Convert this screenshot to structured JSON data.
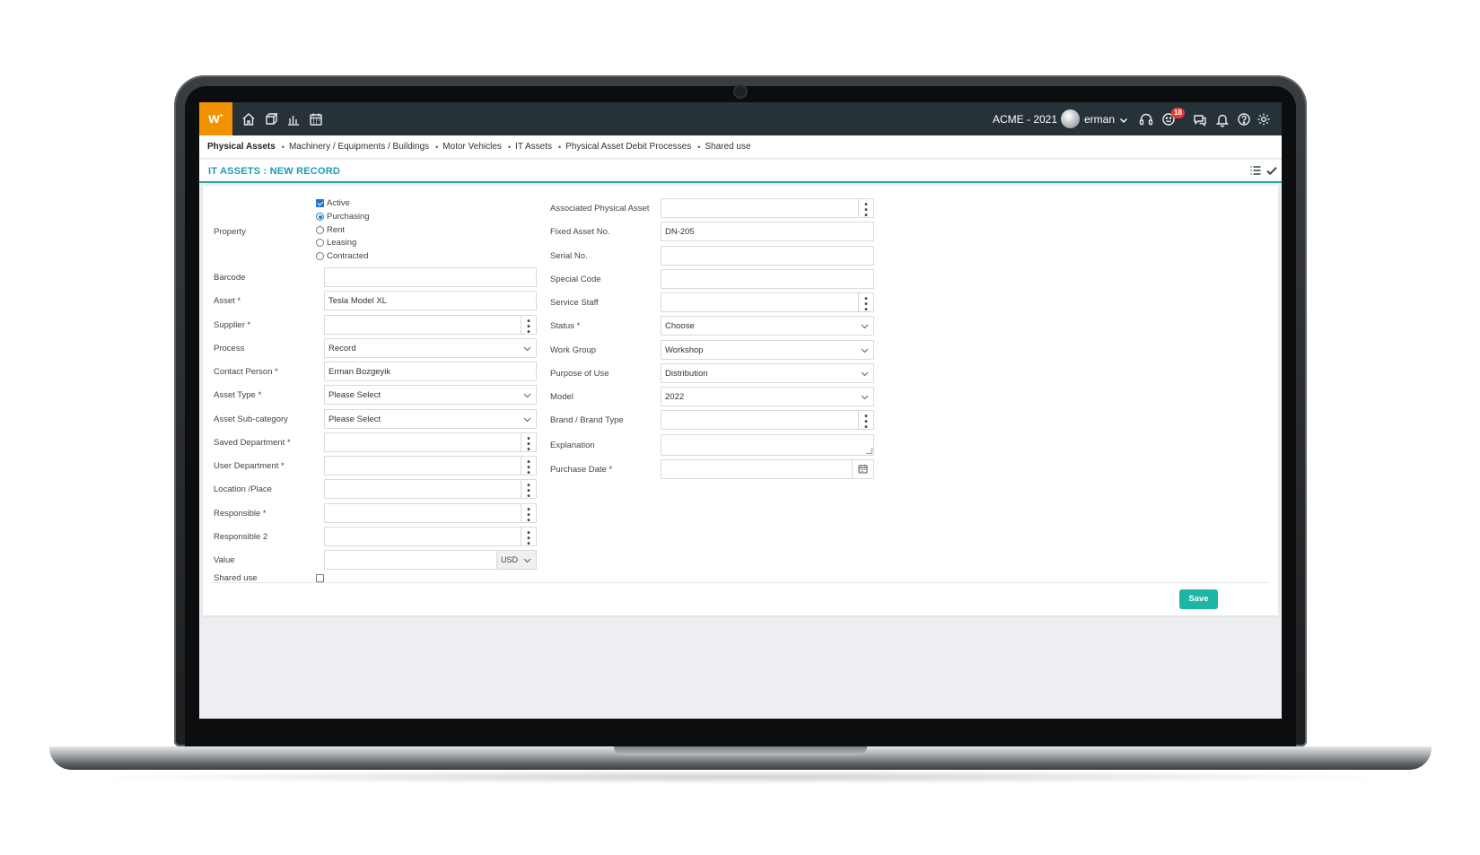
{
  "logo": {
    "text": "w"
  },
  "header": {
    "company": "ACME - 2021",
    "user": "erman",
    "notification_count": "18"
  },
  "breadcrumb": [
    "Physical Assets",
    "Machinery / Equipments / Buildings",
    "Motor Vehicles",
    "IT Assets",
    "Physical Asset Debit Processes",
    "Shared use"
  ],
  "page": {
    "title": "IT ASSETS : NEW RECORD"
  },
  "form_left": {
    "property_label": "Property",
    "active_label": "Active",
    "active_checked": true,
    "property_options": [
      "Purchasing",
      "Rent",
      "Leasing",
      "Contracted"
    ],
    "property_selected": "Purchasing",
    "fields": {
      "barcode": {
        "label": "Barcode",
        "value": ""
      },
      "asset": {
        "label": "Asset *",
        "value": "Tesla Model XL"
      },
      "supplier": {
        "label": "Supplier *",
        "value": ""
      },
      "process": {
        "label": "Process",
        "value": "Record"
      },
      "contact_person": {
        "label": "Contact Person *",
        "value": "Erman Bozgeyik"
      },
      "asset_type": {
        "label": "Asset Type *",
        "value": "Please Select"
      },
      "asset_subcategory": {
        "label": "Asset Sub-category",
        "value": "Please Select"
      },
      "saved_department": {
        "label": "Saved Department *",
        "value": ""
      },
      "user_department": {
        "label": "User Department *",
        "value": ""
      },
      "location": {
        "label": "Location /Place",
        "value": ""
      },
      "responsible": {
        "label": "Responsible *",
        "value": ""
      },
      "responsible2": {
        "label": "Responsible 2",
        "value": ""
      },
      "value": {
        "label": "Value",
        "value": "",
        "currency": "USD"
      },
      "shared_use": {
        "label": "Shared use",
        "checked": false
      }
    }
  },
  "form_right": {
    "associated_physical_asset": {
      "label": "Associated Physical Asset",
      "value": ""
    },
    "fixed_asset_no": {
      "label": "Fixed Asset No.",
      "value": "DN-205"
    },
    "serial_no": {
      "label": "Serial No.",
      "value": ""
    },
    "special_code": {
      "label": "Special Code",
      "value": ""
    },
    "service_staff": {
      "label": "Service Staff",
      "value": ""
    },
    "status": {
      "label": "Status *",
      "value": "Choose"
    },
    "work_group": {
      "label": "Work Group",
      "value": "Workshop"
    },
    "purpose_of_use": {
      "label": "Purpose of Use",
      "value": "Distribution"
    },
    "model": {
      "label": "Model",
      "value": "2022"
    },
    "brand": {
      "label": "Brand / Brand Type",
      "value": ""
    },
    "explanation": {
      "label": "Explanation",
      "value": ""
    },
    "purchase_date": {
      "label": "Purchase Date *",
      "value": ""
    }
  },
  "actions": {
    "save_label": "Save"
  },
  "colors": {
    "topbar": "#263238",
    "logo": "#f39200",
    "accent": "#1cb5a6",
    "title": "#1e9bb5",
    "badge": "#e53935"
  }
}
